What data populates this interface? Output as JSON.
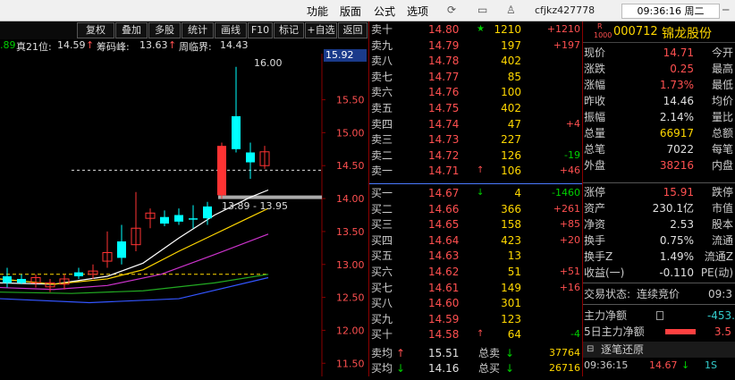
{
  "topbar": {
    "menus": [
      "功能",
      "版面",
      "公式",
      "选项"
    ],
    "username": "cfjkz427778",
    "clock": "09:36:16 周二"
  },
  "toolbar": {
    "buttons": [
      "复权",
      "叠加",
      "多股",
      "统计",
      "画线",
      "F10",
      "标记",
      "+自选",
      "返回"
    ]
  },
  "indicator_line": {
    "lead": ".89",
    "truth21_label": "真21位:",
    "truth21_value": "14.59",
    "chips_label": "筹码峰:",
    "chips_value": "13.63",
    "boundary_label": "周临界:",
    "boundary_value": "14.43"
  },
  "chart": {
    "price_label_high": "16.00",
    "price_label_range": "13.89 - 13.95",
    "current_price_tag": "15.92",
    "axis_ticks": [
      "15.50",
      "15.00",
      "14.50",
      "14.00",
      "13.50",
      "13.00",
      "12.50",
      "12.00",
      "11.50"
    ]
  },
  "chart_data": {
    "type": "candlestick",
    "title": "",
    "ylim": [
      11.3,
      16.2
    ],
    "y_ticks": [
      15.5,
      15.0,
      14.5,
      14.0,
      13.5,
      13.0,
      12.5,
      12.0,
      11.5
    ],
    "candles": [
      {
        "o": 12.82,
        "h": 12.95,
        "l": 12.65,
        "c": 12.72,
        "up": false
      },
      {
        "o": 12.78,
        "h": 12.85,
        "l": 12.7,
        "c": 12.72,
        "up": false
      },
      {
        "o": 12.72,
        "h": 12.85,
        "l": 12.65,
        "c": 12.8,
        "up": true
      },
      {
        "o": 12.66,
        "h": 12.78,
        "l": 12.58,
        "c": 12.72,
        "up": true
      },
      {
        "o": 12.7,
        "h": 12.85,
        "l": 12.62,
        "c": 12.78,
        "up": true
      },
      {
        "o": 12.88,
        "h": 12.95,
        "l": 12.78,
        "c": 12.82,
        "up": false
      },
      {
        "o": 12.85,
        "h": 13.0,
        "l": 12.78,
        "c": 12.9,
        "up": true
      },
      {
        "o": 13.05,
        "h": 13.5,
        "l": 12.95,
        "c": 13.18,
        "up": true
      },
      {
        "o": 13.35,
        "h": 13.6,
        "l": 13.0,
        "c": 13.1,
        "up": false
      },
      {
        "o": 13.3,
        "h": 14.1,
        "l": 13.2,
        "c": 13.55,
        "up": true
      },
      {
        "o": 13.7,
        "h": 13.85,
        "l": 13.55,
        "c": 13.78,
        "up": true
      },
      {
        "o": 13.72,
        "h": 13.82,
        "l": 13.58,
        "c": 13.62,
        "up": false
      },
      {
        "o": 13.75,
        "h": 13.85,
        "l": 13.6,
        "c": 13.65,
        "up": false
      },
      {
        "o": 13.7,
        "h": 13.9,
        "l": 13.55,
        "c": 13.68,
        "up": false
      },
      {
        "o": 13.7,
        "h": 13.95,
        "l": 13.6,
        "c": 13.88,
        "up": false
      },
      {
        "o": 14.05,
        "h": 14.85,
        "l": 14.0,
        "c": 14.8,
        "up": true,
        "solid": true
      },
      {
        "o": 14.75,
        "h": 16.0,
        "l": 14.7,
        "c": 15.25,
        "up": false
      },
      {
        "o": 14.55,
        "h": 14.85,
        "l": 14.3,
        "c": 14.7,
        "up": false
      },
      {
        "o": 14.5,
        "h": 14.8,
        "l": 14.45,
        "c": 14.71,
        "up": true
      }
    ]
  },
  "orderbook": {
    "asks": [
      {
        "label": "卖十",
        "price": "14.80",
        "arrow": "★",
        "vol": "1210",
        "chg": "+1210"
      },
      {
        "label": "卖九",
        "price": "14.79",
        "arrow": "",
        "vol": "197",
        "chg": "+197"
      },
      {
        "label": "卖八",
        "price": "14.78",
        "arrow": "",
        "vol": "402",
        "chg": ""
      },
      {
        "label": "卖七",
        "price": "14.77",
        "arrow": "",
        "vol": "85",
        "chg": ""
      },
      {
        "label": "卖六",
        "price": "14.76",
        "arrow": "",
        "vol": "100",
        "chg": ""
      },
      {
        "label": "卖五",
        "price": "14.75",
        "arrow": "",
        "vol": "402",
        "chg": ""
      },
      {
        "label": "卖四",
        "price": "14.74",
        "arrow": "",
        "vol": "47",
        "chg": "+4"
      },
      {
        "label": "卖三",
        "price": "14.73",
        "arrow": "",
        "vol": "227",
        "chg": ""
      },
      {
        "label": "卖二",
        "price": "14.72",
        "arrow": "",
        "vol": "126",
        "chg": "-19"
      },
      {
        "label": "卖一",
        "price": "14.71",
        "arrow": "↑",
        "vol": "106",
        "chg": "+46"
      }
    ],
    "bids": [
      {
        "label": "买一",
        "price": "14.67",
        "arrow": "↓",
        "vol": "4",
        "chg": "-1460"
      },
      {
        "label": "买二",
        "price": "14.66",
        "arrow": "",
        "vol": "366",
        "chg": "+261"
      },
      {
        "label": "买三",
        "price": "14.65",
        "arrow": "",
        "vol": "158",
        "chg": "+85"
      },
      {
        "label": "买四",
        "price": "14.64",
        "arrow": "",
        "vol": "423",
        "chg": "+20"
      },
      {
        "label": "买五",
        "price": "14.63",
        "arrow": "",
        "vol": "13",
        "chg": ""
      },
      {
        "label": "买六",
        "price": "14.62",
        "arrow": "",
        "vol": "51",
        "chg": "+51"
      },
      {
        "label": "买七",
        "price": "14.61",
        "arrow": "",
        "vol": "149",
        "chg": "+16"
      },
      {
        "label": "买八",
        "price": "14.60",
        "arrow": "",
        "vol": "301",
        "chg": ""
      },
      {
        "label": "买九",
        "price": "14.59",
        "arrow": "",
        "vol": "123",
        "chg": ""
      },
      {
        "label": "买十",
        "price": "14.58",
        "arrow": "↑",
        "vol": "64",
        "chg": "-4"
      }
    ],
    "summary": [
      {
        "label": "卖均",
        "arrow": "↑",
        "price": "15.51",
        "label2": "总卖",
        "arrow2": "↓",
        "vol": "37764"
      },
      {
        "label": "买均",
        "arrow": "↓",
        "price": "14.16",
        "label2": "总买",
        "arrow2": "↓",
        "vol": "26716"
      }
    ]
  },
  "quote": {
    "badge_top": "R",
    "badge_bottom": "1000",
    "code": "000712",
    "name": "锦龙股份",
    "rows": [
      {
        "l1": "现价",
        "v1": "14.71",
        "l2": "今开"
      },
      {
        "l1": "涨跌",
        "v1": "0.25",
        "l2": "最高"
      },
      {
        "l1": "涨幅",
        "v1": "1.73%",
        "l2": "最低"
      },
      {
        "l1": "昨收",
        "v1": "14.46",
        "l2": "均价"
      },
      {
        "l1": "振幅",
        "v1": "2.14%",
        "l2": "量比"
      },
      {
        "l1": "总量",
        "v1": "66917",
        "l2": "总额"
      },
      {
        "l1": "总笔",
        "v1": "7022",
        "l2": "每笔"
      },
      {
        "l1": "外盘",
        "v1": "38216",
        "l2": "内盘"
      }
    ],
    "rows2": [
      {
        "l1": "涨停",
        "v1": "15.91",
        "l2": "跌停"
      },
      {
        "l1": "资产",
        "v1": "230.1亿",
        "l2": "市值"
      },
      {
        "l1": "净资",
        "v1": "2.53",
        "l2": "股本"
      },
      {
        "l1": "换手",
        "v1": "0.75%",
        "l2": "流通"
      },
      {
        "l1": "换手Z",
        "v1": "1.49%",
        "l2": "流通Z"
      },
      {
        "l1": "收益(一)",
        "v1": "-0.110",
        "l2": "PE(动)"
      }
    ],
    "trade_state_label": "交易状态:",
    "trade_state_value": "连续竞价",
    "trade_state_time": "09:3",
    "main_net_label": "主力净额",
    "main_net_value": "-453.",
    "main5_label": "5日主力净额",
    "main5_value": "3.5",
    "restore_label": "逐笔还原",
    "tick_time": "09:36:15",
    "tick_price": "14.67",
    "tick_side": "1S"
  },
  "colors": {
    "up": "#ff3333",
    "down": "#00ffff",
    "grid": "#8b0000",
    "accent": "#ffd700"
  }
}
